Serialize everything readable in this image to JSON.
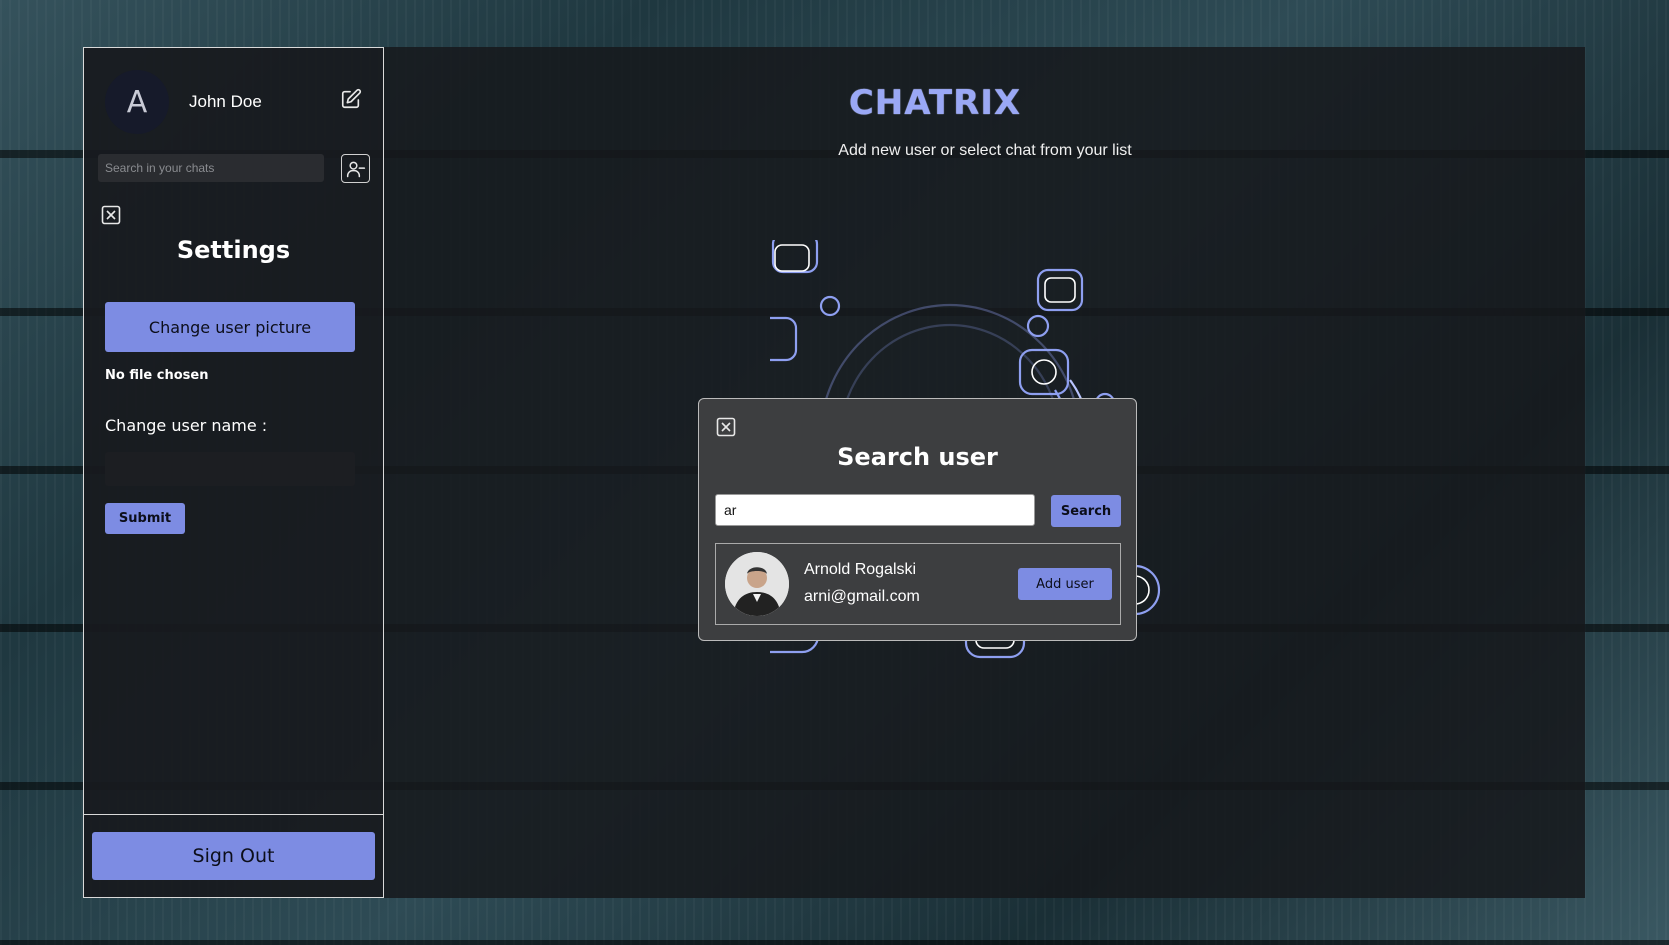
{
  "sidebar": {
    "avatar_letter": "A",
    "user_name": "John Doe",
    "chat_search_placeholder": "Search in your chats",
    "settings_title": "Settings",
    "change_picture_label": "Change user picture",
    "file_status": "No file chosen",
    "change_name_label": "Change user name :",
    "change_name_value": "",
    "submit_label": "Submit",
    "sign_out_label": "Sign Out"
  },
  "main": {
    "logo": "CHATRIX",
    "subtitle": "Add new user or select chat from your list"
  },
  "search_modal": {
    "title": "Search user",
    "query": "ar",
    "search_label": "Search",
    "result": {
      "name": "Arnold Rogalski",
      "email": "arni@gmail.com",
      "add_label": "Add user"
    }
  },
  "colors": {
    "accent": "#7d8ce3",
    "logo": "#9aa8f5",
    "panel": "#3d3e40"
  },
  "icons": [
    "edit-icon",
    "add-user-icon",
    "close-icon"
  ]
}
